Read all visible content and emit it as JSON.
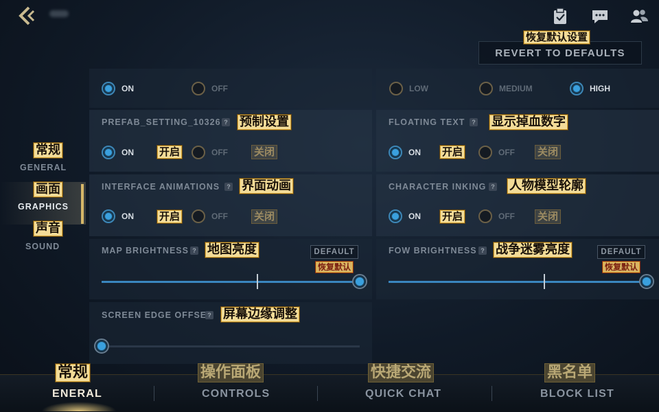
{
  "top": {
    "icons": [
      "back-arrow-icon",
      "clipboard-icon",
      "chat-icon",
      "friends-icon"
    ]
  },
  "revert": {
    "label": "REVERT TO DEFAULTS",
    "annotation": "恢复默认设置"
  },
  "sidebar": {
    "items": [
      {
        "label": "GENERAL",
        "annotation": "常规"
      },
      {
        "label": "GRAPHICS",
        "annotation": "画面"
      },
      {
        "label": "SOUND",
        "annotation": "声音"
      }
    ],
    "active": "GRAPHICS"
  },
  "settings": {
    "row0_left": {
      "on": "ON",
      "off": "OFF",
      "selected": "ON"
    },
    "row0_right": {
      "low": "LOW",
      "medium": "MEDIUM",
      "high": "HIGH",
      "selected": "HIGH"
    },
    "prefab": {
      "title": "PREFAB_SETTING_10326",
      "annotation": "预制设置",
      "on": "ON",
      "off": "OFF",
      "on_annot": "开启",
      "off_annot": "关闭",
      "selected": "ON"
    },
    "floating_text": {
      "title": "FLOATING TEXT",
      "annotation": "显示掉血数字",
      "on": "ON",
      "off": "OFF",
      "on_annot": "开启",
      "off_annot": "关闭",
      "selected": "ON"
    },
    "interface_animations": {
      "title": "INTERFACE ANIMATIONS",
      "annotation": "界面动画",
      "on": "ON",
      "off": "OFF",
      "on_annot": "开启",
      "off_annot": "关闭",
      "selected": "ON"
    },
    "character_inking": {
      "title": "CHARACTER INKING",
      "annotation": "人物模型轮廓",
      "on": "ON",
      "off": "OFF",
      "on_annot": "开启",
      "off_annot": "关闭",
      "selected": "ON"
    },
    "map_brightness": {
      "title": "MAP BRIGHTNESS",
      "annotation": "地图亮度",
      "default_label": "DEFAULT",
      "default_annot": "恢复默认",
      "value": 1.0,
      "default_mark": 0.6
    },
    "fow_brightness": {
      "title": "FOW BRIGHTNESS",
      "annotation": "战争迷雾亮度",
      "default_label": "DEFAULT",
      "default_annot": "恢复默认",
      "value": 1.0,
      "default_mark": 0.6
    },
    "screen_edge": {
      "title": "SCREEN EDGE OFFSET",
      "annotation": "屏幕边缘调整",
      "value": 0.0
    }
  },
  "bottom_tabs": [
    {
      "label": "ENERAL",
      "annotation": "常规"
    },
    {
      "label": "CONTROLS",
      "annotation": "操作面板"
    },
    {
      "label": "QUICK CHAT",
      "annotation": "快捷交流"
    },
    {
      "label": "BLOCK LIST",
      "annotation": "黑名单"
    }
  ],
  "colors": {
    "accent_blue": "#3aa0de",
    "gold": "#d6b768",
    "annotation_bg": "#f3dc98"
  }
}
